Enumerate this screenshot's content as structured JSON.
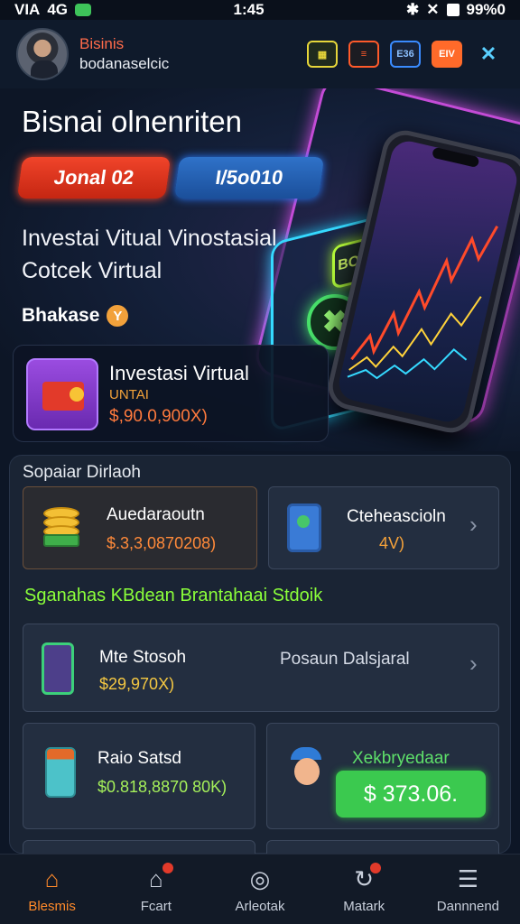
{
  "status": {
    "carrier": "VIA",
    "network": "4G",
    "time": "1:45",
    "battery": "99%0"
  },
  "header": {
    "name": "Bisinis",
    "handle": "bodanaselcic",
    "icons": [
      "app-icon-yellow",
      "app-icon-red",
      "app-icon-blue",
      "app-icon-orange",
      "shuffle-icon"
    ],
    "icon_labels": [
      "",
      "",
      "E36",
      "EIV",
      "✕"
    ]
  },
  "hero": {
    "title": "Bisnai olnenriten",
    "pill_red": "Jonal 02",
    "pill_blue": "I/5o010",
    "line1": "Investai Vitual Vinostasial",
    "line2": "Cotcek Virtual",
    "small_label": "Bhakase",
    "panel_label": "BOOB0 BOSC"
  },
  "feature": {
    "title": "Investasi Virtual",
    "subtitle": "UNTAI",
    "value": "$,90.0,900X)"
  },
  "section": {
    "label": "Sopaiar Dirlaoh",
    "cards": [
      {
        "title": "Auedaraoutn",
        "value": "$.3,3,0870208)"
      },
      {
        "title": "Cteheascioln",
        "value": "4V)"
      }
    ],
    "promo": "Sganahas KBdean Brantahaai Stdoik",
    "wide_card": {
      "title": "Mte Stosoh",
      "value": "$29,970X)",
      "right_label": "Posaun Dalsjaral"
    },
    "card_left": {
      "title": "Raio Satsd",
      "value": "$0.818,8870 80K)"
    },
    "card_right": {
      "title": "Xekbryedaar",
      "button": "$ 373.06."
    }
  },
  "nav": [
    {
      "label": "Blesmis",
      "icon": "home-icon",
      "active": true
    },
    {
      "label": "Fcart",
      "icon": "cart-home-icon",
      "active": false
    },
    {
      "label": "Arleotak",
      "icon": "search-icon",
      "active": false
    },
    {
      "label": "Matark",
      "icon": "refresh-icon",
      "active": false
    },
    {
      "label": "Dannnend",
      "icon": "stack-icon",
      "active": false
    }
  ],
  "colors": {
    "accent": "#ff8a2a",
    "promo": "#8bff3a",
    "value_yellow": "#f5c842",
    "value_green": "#a5f05a"
  }
}
